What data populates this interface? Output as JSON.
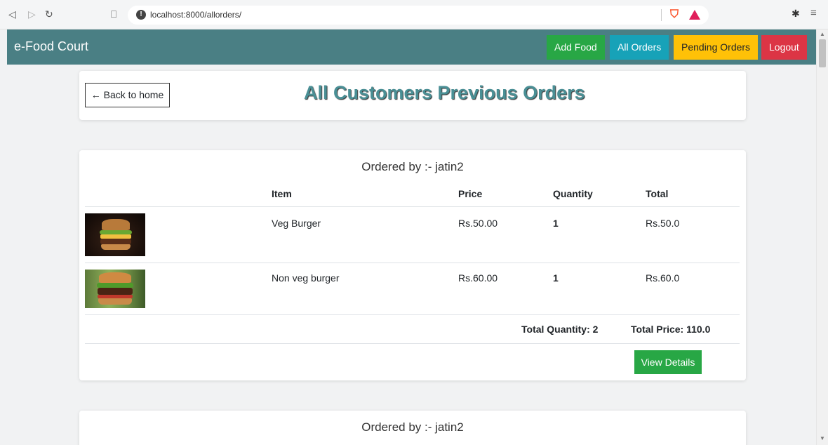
{
  "browser": {
    "url": "localhost:8000/allorders/"
  },
  "navbar": {
    "brand": "e-Food Court",
    "add_food": "Add Food",
    "all_orders": "All Orders",
    "pending_orders": "Pending Orders",
    "logout": "Logout"
  },
  "header": {
    "back_label": "← Back to home",
    "title": "All Customers Previous Orders"
  },
  "table_headers": {
    "item": "Item",
    "price": "Price",
    "quantity": "Quantity",
    "total": "Total"
  },
  "orders": [
    {
      "ordered_by": "Ordered by :- jatin2",
      "items": [
        {
          "name": "Veg Burger",
          "price": "Rs.50.00",
          "quantity": "1",
          "total": "Rs.50.0"
        },
        {
          "name": "Non veg burger",
          "price": "Rs.60.00",
          "quantity": "1",
          "total": "Rs.60.0"
        }
      ],
      "total_quantity": "Total Quantity: 2",
      "total_price": "Total Price: 110.0",
      "view_details": "View Details"
    },
    {
      "ordered_by": "Ordered by :- jatin2"
    }
  ],
  "colors": {
    "navbar": "#4a7f84",
    "title": "#4a8f95",
    "success": "#28a745",
    "info": "#17a2b8",
    "warning": "#ffc107",
    "danger": "#dc3545"
  }
}
